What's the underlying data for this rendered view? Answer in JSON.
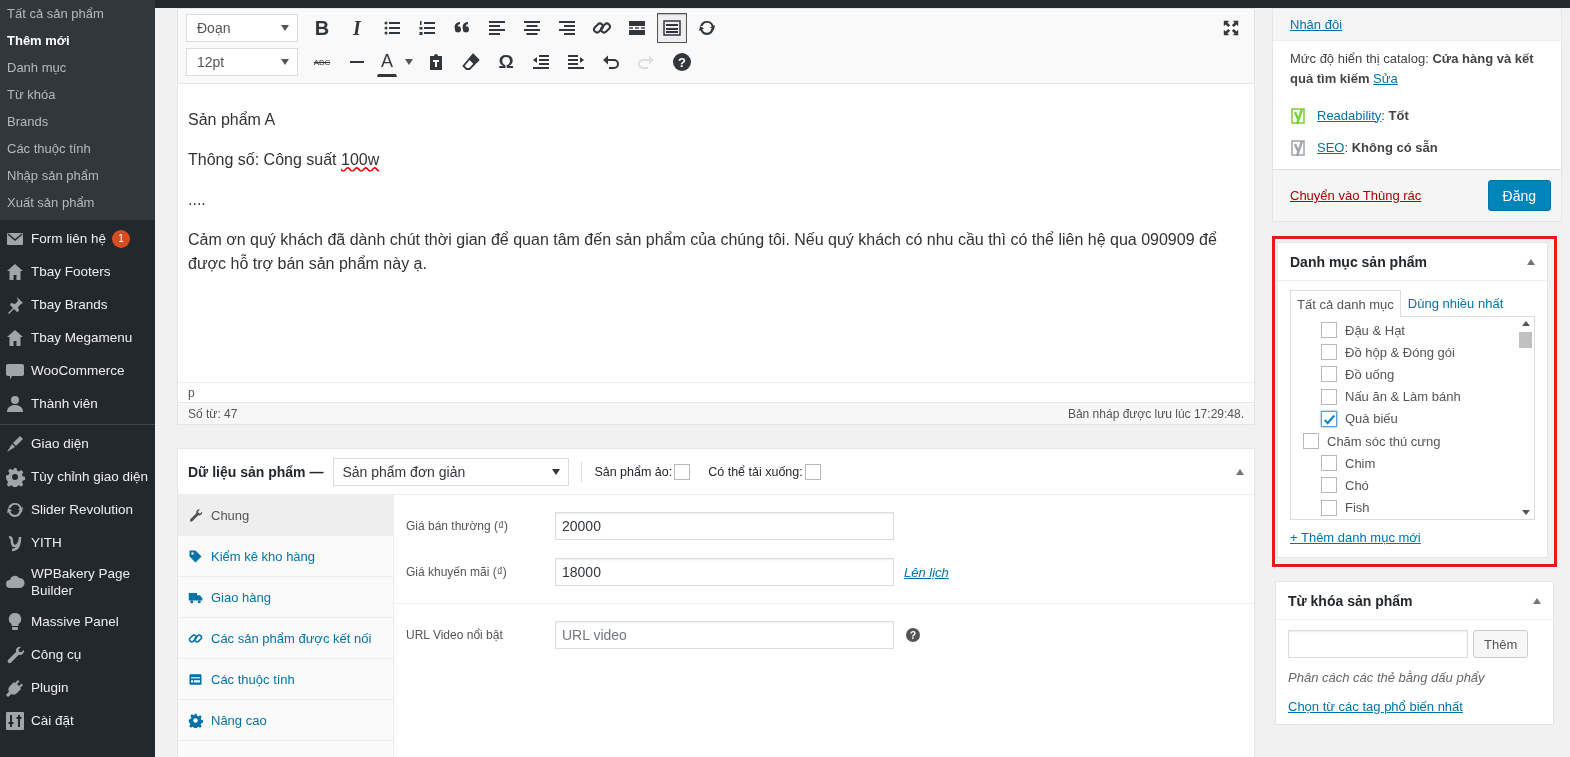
{
  "sidebar": {
    "submenu": [
      {
        "label": "Tất cả sản phẩm",
        "selected": false
      },
      {
        "label": "Thêm mới",
        "selected": true
      },
      {
        "label": "Danh mục",
        "selected": false
      },
      {
        "label": "Từ khóa",
        "selected": false
      },
      {
        "label": "Brands",
        "selected": false
      },
      {
        "label": "Các thuộc tính",
        "selected": false
      },
      {
        "label": "Nhập sản phẩm",
        "selected": false
      },
      {
        "label": "Xuất sản phẩm",
        "selected": false
      }
    ],
    "menu_groups": [
      [
        {
          "label": "Form liên hệ",
          "badge": "1"
        },
        {
          "label": "Tbay Footers"
        },
        {
          "label": "Tbay Brands"
        },
        {
          "label": "Tbay Megamenu"
        },
        {
          "label": "WooCommerce"
        },
        {
          "label": "Thành viên"
        }
      ],
      [
        {
          "label": "Giao diện"
        },
        {
          "label": "Tùy chỉnh giao diện"
        },
        {
          "label": "Slider Revolution"
        },
        {
          "label": "YITH"
        },
        {
          "label": "WPBakery Page Builder"
        },
        {
          "label": "Massive Panel"
        },
        {
          "label": "Công cụ"
        },
        {
          "label": "Plugin"
        },
        {
          "label": "Cài đặt"
        }
      ]
    ]
  },
  "editor": {
    "toolbar": [
      {
        "select": "Đoạn",
        "buttons": [
          {
            "kind": "bold",
            "glyph": "B",
            "pressed": false,
            "disabled": false
          },
          {
            "kind": "italic",
            "glyph": "I",
            "pressed": false,
            "disabled": false
          },
          {
            "kind": "bullist",
            "pressed": false,
            "disabled": false
          },
          {
            "kind": "numlist",
            "pressed": false,
            "disabled": false
          },
          {
            "kind": "blockquote",
            "pressed": false,
            "disabled": false
          },
          {
            "kind": "alignleft",
            "pressed": false,
            "disabled": false
          },
          {
            "kind": "aligncenter",
            "pressed": false,
            "disabled": false
          },
          {
            "kind": "alignright",
            "pressed": false,
            "disabled": false
          },
          {
            "kind": "link",
            "pressed": false,
            "disabled": false
          },
          {
            "kind": "readmore",
            "pressed": false,
            "disabled": false
          },
          {
            "kind": "toolbar",
            "pressed": true,
            "disabled": false
          },
          {
            "kind": "refresh",
            "pressed": false,
            "disabled": false
          }
        ]
      },
      {
        "select": "12pt",
        "buttons": [
          {
            "kind": "strikethrough",
            "glyph": "ABC",
            "pressed": false,
            "disabled": false
          },
          {
            "kind": "hr",
            "pressed": false,
            "disabled": false
          },
          {
            "kind": "forecolor",
            "glyph": "A",
            "pressed": false,
            "disabled": false
          },
          {
            "kind": "pastetext",
            "pressed": false,
            "disabled": false
          },
          {
            "kind": "eraser",
            "pressed": false,
            "disabled": false
          },
          {
            "kind": "charmap",
            "glyph": "Ω",
            "pressed": false,
            "disabled": false
          },
          {
            "kind": "outdent",
            "pressed": false,
            "disabled": false
          },
          {
            "kind": "indent",
            "pressed": false,
            "disabled": false
          },
          {
            "kind": "undo",
            "pressed": false,
            "disabled": false
          },
          {
            "kind": "redo",
            "pressed": false,
            "disabled": true
          },
          {
            "kind": "help",
            "glyph": "?",
            "pressed": false,
            "disabled": false
          }
        ]
      }
    ],
    "content": [
      {
        "segments": [
          {
            "text": "Sản phẩm A",
            "misspelled": false
          }
        ]
      },
      {
        "segments": [
          {
            "text": "Thông số: Công suất ",
            "misspelled": false
          },
          {
            "text": "100w",
            "misspelled": true
          }
        ]
      },
      {
        "segments": [
          {
            "text": "....",
            "misspelled": false
          }
        ]
      },
      {
        "segments": [
          {
            "text": "Cảm ơn quý khách đã dành chút thời gian để quan tâm đến sản phẩm của chúng tôi. Nếu quý khách có nhu cầu thì có thể liên hệ qua 090909 để được hỗ trợ bán sản phẩm này ạ.",
            "misspelled": false
          }
        ]
      }
    ],
    "path": "p",
    "word_count": "Số từ: 47",
    "draft_saved": "Bản nháp được lưu lúc 17:29:48."
  },
  "product_data": {
    "title": "Dữ liệu sản phẩm —",
    "type": "Sản phẩm đơn giản",
    "options": [
      {
        "label": "Sản phẩm ảo:",
        "checked": false
      },
      {
        "label": "Có thể tải xuống:",
        "checked": false
      }
    ],
    "tabs": [
      {
        "label": "Chung",
        "selected": true
      },
      {
        "label": "Kiểm kê kho hàng",
        "selected": false
      },
      {
        "label": "Giao hàng",
        "selected": false
      },
      {
        "label": "Các sản phẩm được kết nối",
        "selected": false
      },
      {
        "label": "Các thuộc tính",
        "selected": false
      },
      {
        "label": "Nâng cao",
        "selected": false
      }
    ],
    "field_groups": [
      [
        {
          "label": "Giá bán thường (₫)",
          "value": "20000"
        },
        {
          "label": "Giá khuyến mãi (₫)",
          "value": "18000",
          "link": "Lên lịch"
        }
      ],
      [
        {
          "label": "URL Video nổi bật",
          "placeholder": "URL video",
          "help": "?"
        }
      ]
    ]
  },
  "publish": {
    "duplicate_link": "Nhân đôi",
    "catalog_visibility": {
      "text": "Mức độ hiển thị catalog: **Cửa hàng và kết quả tìm kiếm**",
      "link": "Sửa"
    },
    "scores": [
      {
        "link": "Readability",
        "text": ": **Tốt**",
        "color": "#7ad03a"
      },
      {
        "link": "SEO",
        "text": ": **Không có sẵn**",
        "color": "#a0a5aa"
      }
    ],
    "trash_link": "Chuyển vào Thùng rác",
    "publish_button": "Đăng"
  },
  "categories": {
    "title": "Danh mục sản phẩm",
    "tabs": [
      {
        "label": "Tất cả danh mục",
        "selected": true
      },
      {
        "label": "Dùng nhiều nhất",
        "selected": false
      }
    ],
    "items": [
      {
        "children": [
          {
            "label": "Đậu & Hạt",
            "checked": false
          },
          {
            "label": "Đồ hộp & Đóng gói",
            "checked": false
          },
          {
            "label": "Đồ uống",
            "checked": false
          },
          {
            "label": "Nấu ăn & Làm bánh",
            "checked": false
          },
          {
            "label": "Quà biếu",
            "checked": true
          }
        ]
      },
      {
        "label": "Chăm sóc thú cưng",
        "checked": false,
        "children": [
          {
            "label": "Chim",
            "checked": false
          },
          {
            "label": "Chó",
            "checked": false
          },
          {
            "label": "Fish",
            "checked": false
          }
        ]
      }
    ],
    "add_link": "+ Thêm danh mục mới"
  },
  "tags": {
    "title": "Từ khóa sản phẩm",
    "button": "Thêm",
    "hint": "Phân cách các thẻ bằng dấu phẩy",
    "link": "Chọn từ các tag phổ biến nhất"
  }
}
